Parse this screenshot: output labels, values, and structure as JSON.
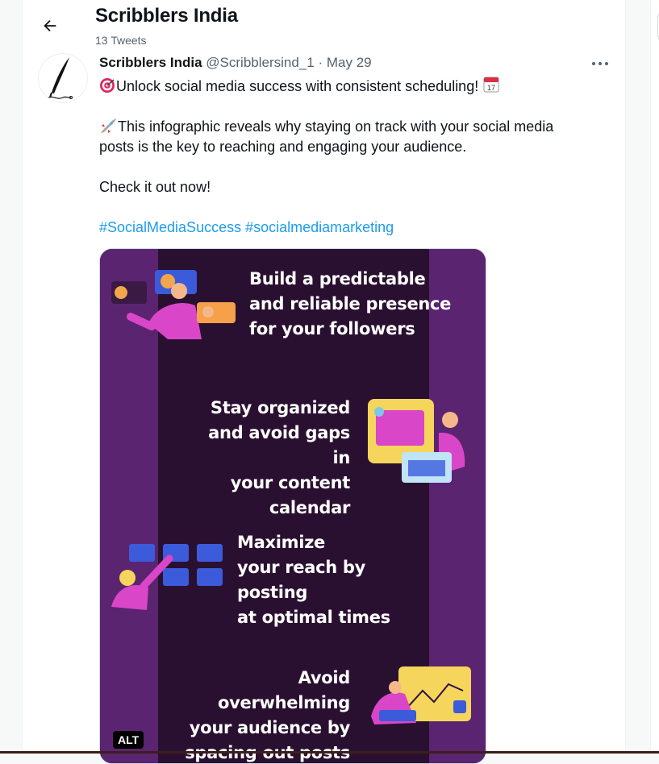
{
  "header": {
    "title": "Scribblers India",
    "subtitle": "13 Tweets"
  },
  "tweet": {
    "author_name": "Scribblers India",
    "author_handle": "@Scribblersind_1",
    "separator": "·",
    "date": "May 29",
    "line1": "Unlock social media success with consistent scheduling!",
    "line2a": "This infographic reveals why staying on track with your social media",
    "line2b": "posts is the key to reaching and engaging your audience.",
    "line3": "Check it out now!",
    "hashtag1": "#SocialMediaSuccess",
    "hashtag2": "#socialmediamarketing"
  },
  "media": {
    "text1": "Build a predictable\nand reliable presence\nfor your followers",
    "text2": "Stay organized\nand avoid gaps in\nyour content\ncalendar",
    "text3": "Maximize\nyour reach by\nposting\nat optimal times",
    "text4": "Avoid overwhelming\nyour audience by\nspacing out posts",
    "alt_label": "ALT",
    "calendar_label": "17"
  },
  "colors": {
    "link": "#1d9bf0",
    "infographic_bg": "#2f1338",
    "infographic_stripe": "#5b2470",
    "accent_pink": "#d946c8",
    "accent_blue": "#3b5bdb",
    "accent_yellow": "#f6d55c"
  },
  "icons": {
    "back": "back-arrow-icon",
    "more": "more-dots-icon",
    "target": "target-emoji-icon",
    "calendar": "calendar-emoji-icon",
    "rocket": "rocket-emoji-icon"
  }
}
